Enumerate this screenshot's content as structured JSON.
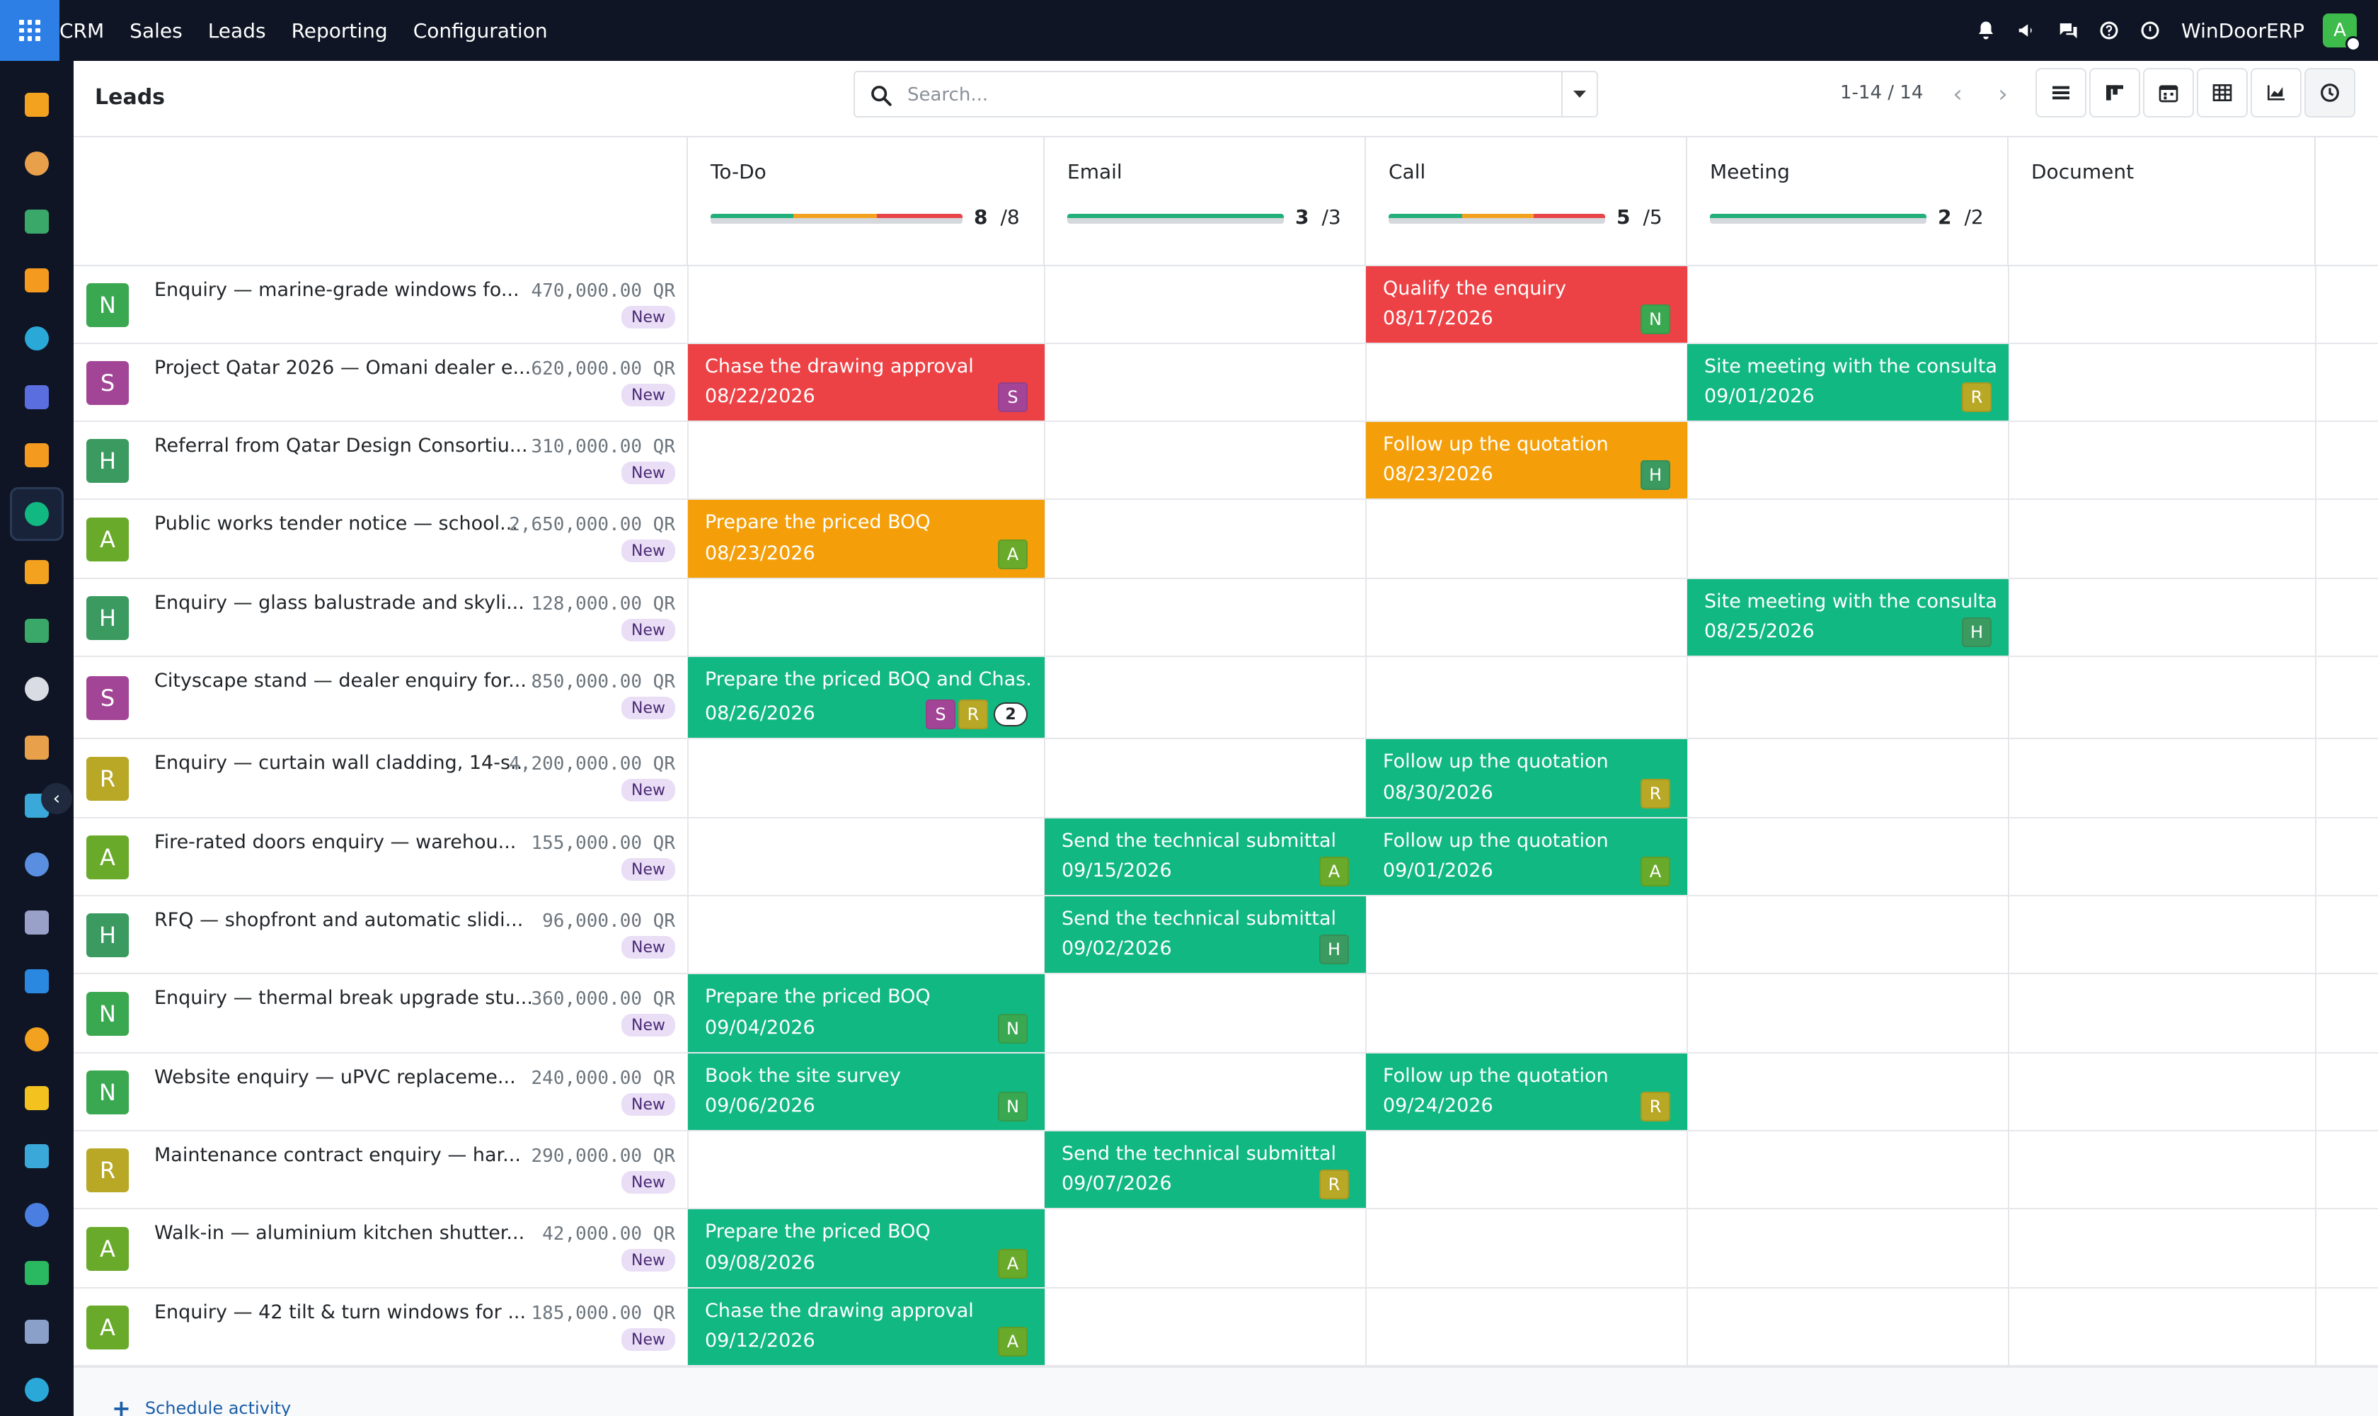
{
  "topbar": {
    "menu": [
      "CRM",
      "Sales",
      "Leads",
      "Reporting",
      "Configuration"
    ],
    "company": "WinDoorERP",
    "user_initial": "A",
    "icons": [
      "bell-icon",
      "megaphone-icon",
      "chat-icon",
      "help-icon",
      "clock-icon"
    ]
  },
  "sidebar": {
    "icons": [
      "crm-app-icon",
      "paint-icon",
      "contacts-icon",
      "chat-bubble-icon",
      "wave-icon",
      "mail-icon",
      "discuss-icon",
      "activity-app-icon",
      "chart-icon",
      "badge-icon",
      "box-icon",
      "brush-icon",
      "check-icon",
      "book-icon",
      "cube-icon",
      "invoice-icon",
      "team-icon",
      "calendar-icon",
      "sign-icon",
      "dashboard-icon",
      "whatsapp-icon",
      "gauge-icon",
      "wave2-icon"
    ]
  },
  "control_panel": {
    "title": "Leads",
    "search_placeholder": "Search...",
    "pager": "1-14 / 14",
    "views": [
      "list-view",
      "kanban-view",
      "calendar-view",
      "pivot-view",
      "graph-view",
      "activity-view"
    ]
  },
  "columns": [
    {
      "title": "To-Do",
      "done": "8",
      "total": "/8",
      "segments": [
        {
          "color": "#21b07a",
          "pct": 33
        },
        {
          "color": "#f3a21f",
          "pct": 33
        },
        {
          "color": "#e8454a",
          "pct": 34
        }
      ]
    },
    {
      "title": "Email",
      "done": "3",
      "total": "/3",
      "segments": [
        {
          "color": "#21b07a",
          "pct": 100
        }
      ]
    },
    {
      "title": "Call",
      "done": "5",
      "total": "/5",
      "segments": [
        {
          "color": "#21b07a",
          "pct": 34
        },
        {
          "color": "#f3a21f",
          "pct": 33
        },
        {
          "color": "#e8454a",
          "pct": 33
        }
      ]
    },
    {
      "title": "Meeting",
      "done": "2",
      "total": "/2",
      "segments": [
        {
          "color": "#21b07a",
          "pct": 100
        }
      ]
    },
    {
      "title": "Document",
      "done": "",
      "total": "",
      "segments": []
    }
  ],
  "leads": [
    {
      "initial": "N",
      "color": "#3aa850",
      "name": "Enquiry — marine-grade windows fo...",
      "revenue": "470,000.00 QR",
      "stage": "New"
    },
    {
      "initial": "S",
      "color": "#a34596",
      "name": "Project Qatar 2026 — Omani dealer e...",
      "revenue": "620,000.00 QR",
      "stage": "New"
    },
    {
      "initial": "H",
      "color": "#3a9a60",
      "name": "Referral from Qatar Design Consortiu...",
      "revenue": "310,000.00 QR",
      "stage": "New"
    },
    {
      "initial": "A",
      "color": "#6aaa2a",
      "name": "Public works tender notice — school...",
      "revenue": "2,650,000.00 QR",
      "stage": "New"
    },
    {
      "initial": "H",
      "color": "#3a9a60",
      "name": "Enquiry — glass balustrade and skyli...",
      "revenue": "128,000.00 QR",
      "stage": "New"
    },
    {
      "initial": "S",
      "color": "#a34596",
      "name": "Cityscape stand — dealer enquiry for...",
      "revenue": "850,000.00 QR",
      "stage": "New"
    },
    {
      "initial": "R",
      "color": "#b8a826",
      "name": "Enquiry — curtain wall cladding, 14-s...",
      "revenue": "4,200,000.00 QR",
      "stage": "New"
    },
    {
      "initial": "A",
      "color": "#6aaa2a",
      "name": "Fire-rated doors enquiry — warehou...",
      "revenue": "155,000.00 QR",
      "stage": "New"
    },
    {
      "initial": "H",
      "color": "#3a9a60",
      "name": "RFQ — shopfront and automatic slidi...",
      "revenue": "96,000.00 QR",
      "stage": "New"
    },
    {
      "initial": "N",
      "color": "#3aa850",
      "name": "Enquiry — thermal break upgrade stu...",
      "revenue": "360,000.00 QR",
      "stage": "New"
    },
    {
      "initial": "N",
      "color": "#3aa850",
      "name": "Website enquiry — uPVC replaceme...",
      "revenue": "240,000.00 QR",
      "stage": "New"
    },
    {
      "initial": "R",
      "color": "#b8a826",
      "name": "Maintenance contract enquiry — har...",
      "revenue": "290,000.00 QR",
      "stage": "New"
    },
    {
      "initial": "A",
      "color": "#6aaa2a",
      "name": "Walk-in — aluminium kitchen shutter...",
      "revenue": "42,000.00 QR",
      "stage": "New"
    },
    {
      "initial": "A",
      "color": "#6aaa2a",
      "name": "Enquiry — 42 tilt & turn windows for ...",
      "revenue": "185,000.00 QR",
      "stage": "New"
    }
  ],
  "activities": [
    {
      "row": 0,
      "col": 2,
      "state": "red",
      "summary": "Qualify the enquiry",
      "date": "08/17/2026",
      "users": [
        {
          "i": "N",
          "c": "#3aa850"
        }
      ]
    },
    {
      "row": 1,
      "col": 0,
      "state": "red",
      "summary": "Chase the drawing approval",
      "date": "08/22/2026",
      "users": [
        {
          "i": "S",
          "c": "#a34596"
        }
      ]
    },
    {
      "row": 1,
      "col": 3,
      "state": "green",
      "summary": "Site meeting with the consultant",
      "date": "09/01/2026",
      "users": [
        {
          "i": "R",
          "c": "#b8a826"
        }
      ]
    },
    {
      "row": 2,
      "col": 2,
      "state": "orange",
      "summary": "Follow up the quotation",
      "date": "08/23/2026",
      "users": [
        {
          "i": "H",
          "c": "#3a9a60"
        }
      ]
    },
    {
      "row": 3,
      "col": 0,
      "state": "orange",
      "summary": "Prepare the priced BOQ",
      "date": "08/23/2026",
      "users": [
        {
          "i": "A",
          "c": "#6aaa2a"
        }
      ]
    },
    {
      "row": 4,
      "col": 3,
      "state": "green",
      "summary": "Site meeting with the consultant",
      "date": "08/25/2026",
      "users": [
        {
          "i": "H",
          "c": "#3a9a60"
        }
      ]
    },
    {
      "row": 5,
      "col": 0,
      "state": "green",
      "summary": "Prepare the priced BOQ and Chas...",
      "date": "08/26/2026",
      "users": [
        {
          "i": "S",
          "c": "#a34596"
        },
        {
          "i": "R",
          "c": "#b8a826"
        }
      ],
      "more": "2"
    },
    {
      "row": 6,
      "col": 2,
      "state": "green",
      "summary": "Follow up the quotation",
      "date": "08/30/2026",
      "users": [
        {
          "i": "R",
          "c": "#b8a826"
        }
      ]
    },
    {
      "row": 7,
      "col": 1,
      "state": "green",
      "summary": "Send the technical submittal",
      "date": "09/15/2026",
      "users": [
        {
          "i": "A",
          "c": "#6aaa2a"
        }
      ]
    },
    {
      "row": 7,
      "col": 2,
      "state": "green",
      "summary": "Follow up the quotation",
      "date": "09/01/2026",
      "users": [
        {
          "i": "A",
          "c": "#6aaa2a"
        }
      ]
    },
    {
      "row": 8,
      "col": 1,
      "state": "green",
      "summary": "Send the technical submittal",
      "date": "09/02/2026",
      "users": [
        {
          "i": "H",
          "c": "#3a9a60"
        }
      ]
    },
    {
      "row": 9,
      "col": 0,
      "state": "green",
      "summary": "Prepare the priced BOQ",
      "date": "09/04/2026",
      "users": [
        {
          "i": "N",
          "c": "#3aa850"
        }
      ]
    },
    {
      "row": 10,
      "col": 0,
      "state": "green",
      "summary": "Book the site survey",
      "date": "09/06/2026",
      "users": [
        {
          "i": "N",
          "c": "#3aa850"
        }
      ]
    },
    {
      "row": 10,
      "col": 2,
      "state": "green",
      "summary": "Follow up the quotation",
      "date": "09/24/2026",
      "users": [
        {
          "i": "R",
          "c": "#b8a826"
        }
      ]
    },
    {
      "row": 11,
      "col": 1,
      "state": "green",
      "summary": "Send the technical submittal",
      "date": "09/07/2026",
      "users": [
        {
          "i": "R",
          "c": "#b8a826"
        }
      ]
    },
    {
      "row": 12,
      "col": 0,
      "state": "green",
      "summary": "Prepare the priced BOQ",
      "date": "09/08/2026",
      "users": [
        {
          "i": "A",
          "c": "#6aaa2a"
        }
      ]
    },
    {
      "row": 13,
      "col": 0,
      "state": "green",
      "summary": "Chase the drawing approval",
      "date": "09/12/2026",
      "users": [
        {
          "i": "A",
          "c": "#6aaa2a"
        }
      ]
    }
  ],
  "footer": {
    "schedule_label": "Schedule activity"
  }
}
